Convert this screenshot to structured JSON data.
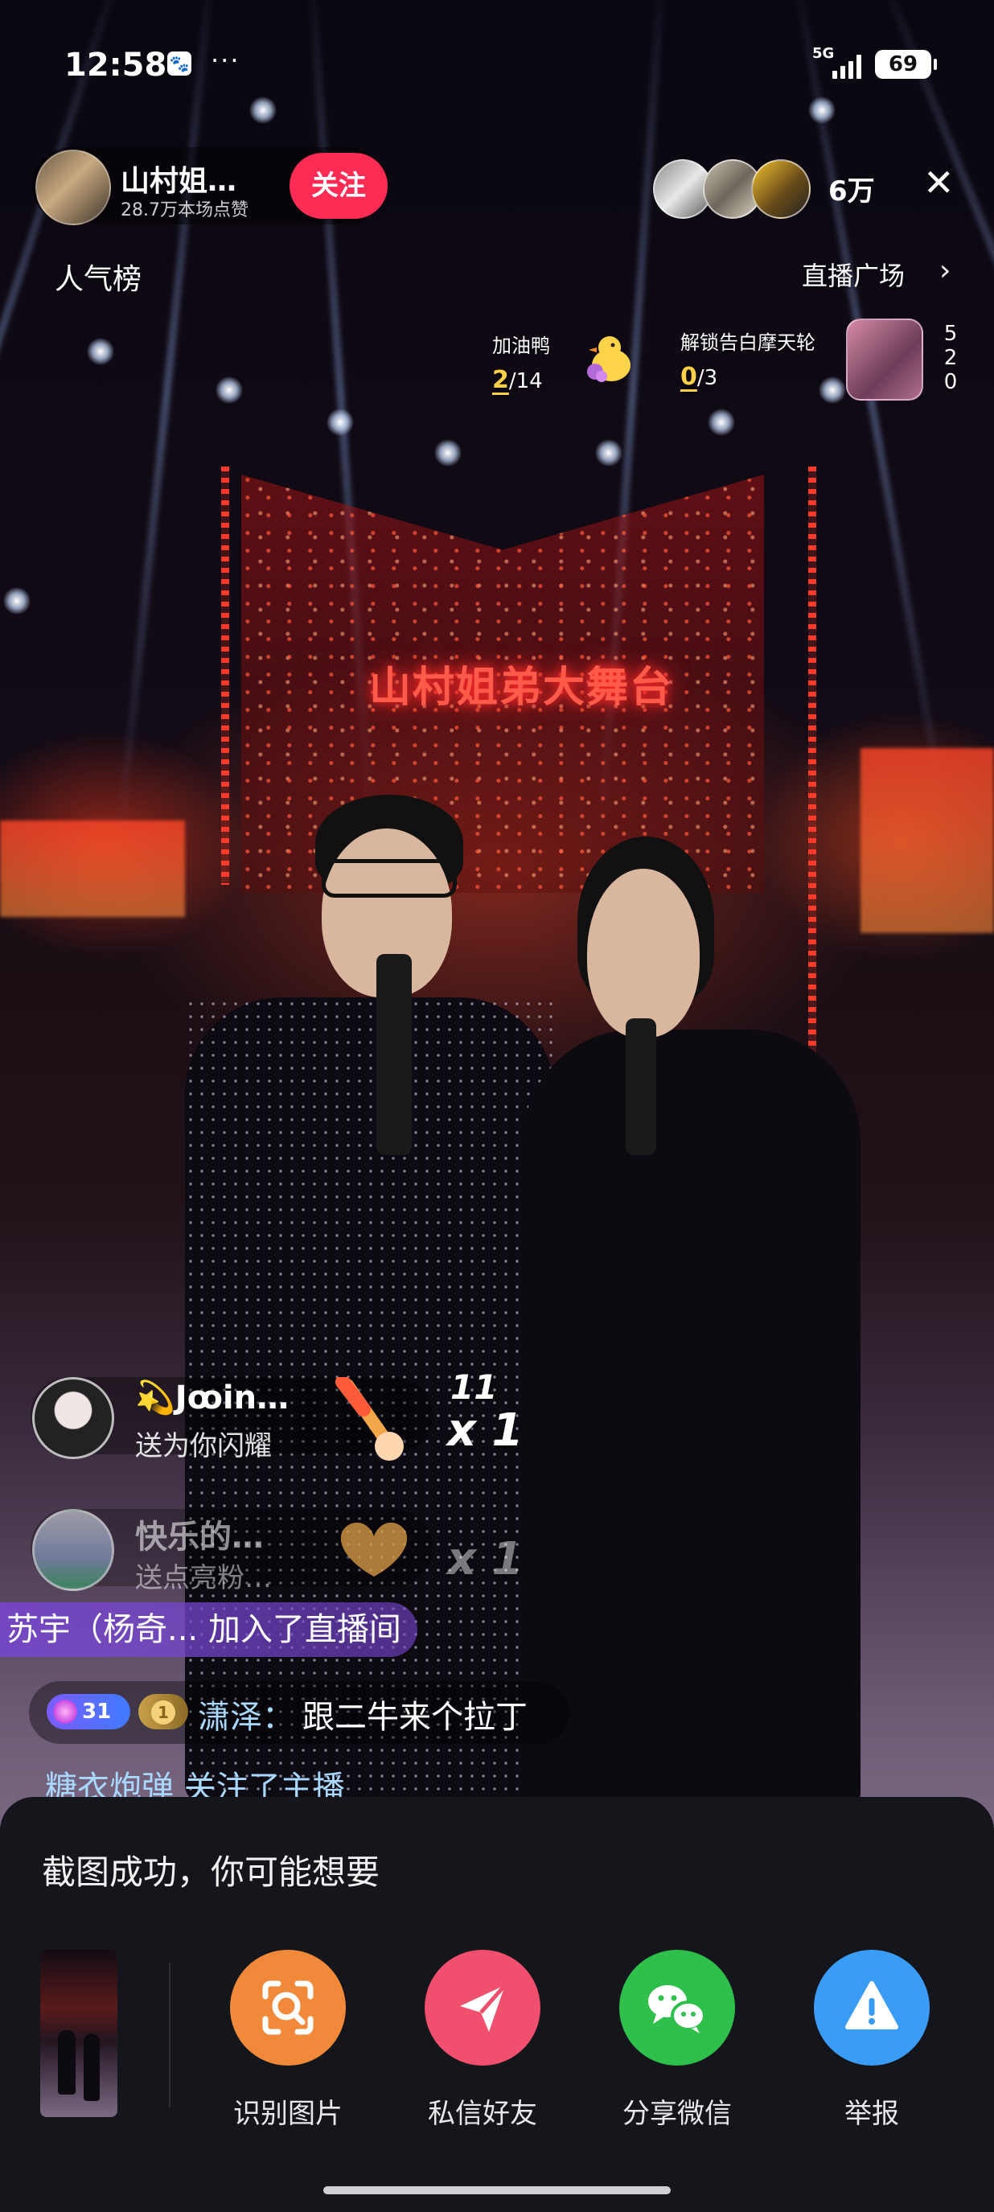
{
  "status_bar": {
    "time": "12:58",
    "app_icon": "baidu-paw-icon",
    "more": "···",
    "network": "5G",
    "battery": "69"
  },
  "host": {
    "name": "山村姐…",
    "likes": "28.7万本场点赞",
    "follow_label": "关注"
  },
  "viewers": {
    "count": "6万"
  },
  "nav": {
    "popularity_rank": "人气榜",
    "live_plaza": "直播广场",
    "plaza_chevron": "›"
  },
  "tasks": [
    {
      "title": "加油鸭",
      "current": "2",
      "total": "/14",
      "icon": "duck-icon"
    },
    {
      "title": "解锁告白摩天轮",
      "current": "0",
      "total": "/3",
      "icon": "ferris-wheel-icon"
    }
  ],
  "side_vertical_text": [
    "5",
    "2",
    "0"
  ],
  "stage_sign": "山村姐弟大舞台",
  "gifts": [
    {
      "name": "💫Jꝏin…",
      "desc": "送为你闪耀",
      "combo": "x 1",
      "combo_top": "11",
      "gift_icon": "torch-gift-icon"
    },
    {
      "name": "快乐的…",
      "desc": "送点亮粉…",
      "combo": "x 1",
      "gift_icon": "heart-hands-gift-icon"
    }
  ],
  "chat": {
    "join_notice": "苏宇（杨奇... 加入了直播间",
    "level_badge": "31",
    "fan_badge": "1",
    "message_user": "潇泽：",
    "message_text": "跟二牛来个拉丁",
    "follow_notice": "糖衣炮弹 关注了主播"
  },
  "sheet": {
    "title": "截图成功，你可能想要",
    "actions": [
      {
        "label": "识别图片",
        "icon": "scan-image-icon",
        "color": "#f08a3a"
      },
      {
        "label": "私信好友",
        "icon": "send-icon",
        "color": "#f0506e"
      },
      {
        "label": "分享微信",
        "icon": "wechat-icon",
        "color": "#2fbf4b"
      },
      {
        "label": "举报",
        "icon": "report-icon",
        "color": "#3b9cf5"
      }
    ]
  }
}
